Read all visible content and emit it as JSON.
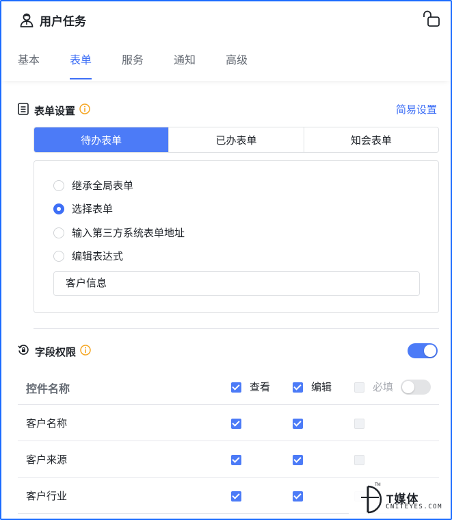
{
  "header": {
    "title": "用户任务",
    "tabs": [
      {
        "label": "基本",
        "active": false
      },
      {
        "label": "表单",
        "active": true
      },
      {
        "label": "服务",
        "active": false
      },
      {
        "label": "通知",
        "active": false
      },
      {
        "label": "高级",
        "active": false
      }
    ]
  },
  "form_settings": {
    "title": "表单设置",
    "simple_link": "简易设置",
    "segments": [
      {
        "label": "待办表单",
        "active": true
      },
      {
        "label": "已办表单",
        "active": false
      },
      {
        "label": "知会表单",
        "active": false
      }
    ],
    "options": [
      {
        "label": "继承全局表单",
        "checked": false
      },
      {
        "label": "选择表单",
        "checked": true
      },
      {
        "label": "输入第三方系统表单地址",
        "checked": false
      },
      {
        "label": "编辑表达式",
        "checked": false
      }
    ],
    "selected_form": "客户信息"
  },
  "field_permissions": {
    "title": "字段权限",
    "enabled": true,
    "columns": {
      "name": "控件名称",
      "view": "查看",
      "edit": "编辑",
      "required": "必填"
    },
    "required_toggle": false,
    "rows": [
      {
        "name": "客户名称",
        "view": true,
        "edit": true,
        "required": false
      },
      {
        "name": "客户来源",
        "view": true,
        "edit": true,
        "required": false
      },
      {
        "name": "客户行业",
        "view": true,
        "edit": true,
        "required": false
      }
    ]
  },
  "watermark": {
    "brand": "T媒体",
    "site": "CNITEYES.COM"
  },
  "colors": {
    "accent": "#3e6ff6",
    "accent_fill": "#4c7bf7",
    "info": "#f5a623",
    "frame": "#1b6cff"
  }
}
